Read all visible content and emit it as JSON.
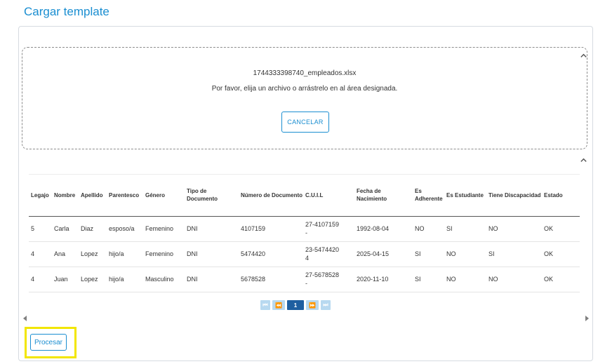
{
  "page": {
    "title": "Cargar template"
  },
  "upload": {
    "file_name": "1744333398740_empleados.xlsx",
    "message": "Por favor, elija un archivo o arrástrelo en al área designada.",
    "cancel_label": "CANCELAR"
  },
  "table": {
    "columns": [
      "Legajo",
      "Nombre",
      "Apellido",
      "Parentesco",
      "Género",
      "Tipo de Documento",
      "Número de Documento",
      "C.U.I.L",
      "Fecha de Nacimiento",
      "Es Adherente",
      "Es Estudiante",
      "Tiene Discapacidad",
      "Estado"
    ],
    "rows": [
      [
        "5",
        "Carla",
        "Diaz",
        "esposo/a",
        "Femenino",
        "DNI",
        "4107159",
        "27-4107159 -",
        "1992-08-04",
        "NO",
        "SI",
        "NO",
        "OK"
      ],
      [
        "4",
        "Ana",
        "Lopez",
        "hijo/a",
        "Femenino",
        "DNI",
        "5474420",
        "23-5474420 4",
        "2025-04-15",
        "SI",
        "NO",
        "SI",
        "OK"
      ],
      [
        "4",
        "Juan",
        "Lopez",
        "hijo/a",
        "Masculino",
        "DNI",
        "5678528",
        "27-5678528 -",
        "2020-11-10",
        "SI",
        "NO",
        "NO",
        "OK"
      ]
    ]
  },
  "pagination": {
    "first": "⏮",
    "prev": "⏪",
    "current_page": "1",
    "next": "⏩",
    "last": "⏭"
  },
  "actions": {
    "process_label": "Procesar"
  },
  "colors": {
    "accent": "#1a8ed1",
    "pager_active": "#1f5fa0",
    "pager_inactive": "#b8d9f0",
    "highlight": "#f2e600"
  }
}
